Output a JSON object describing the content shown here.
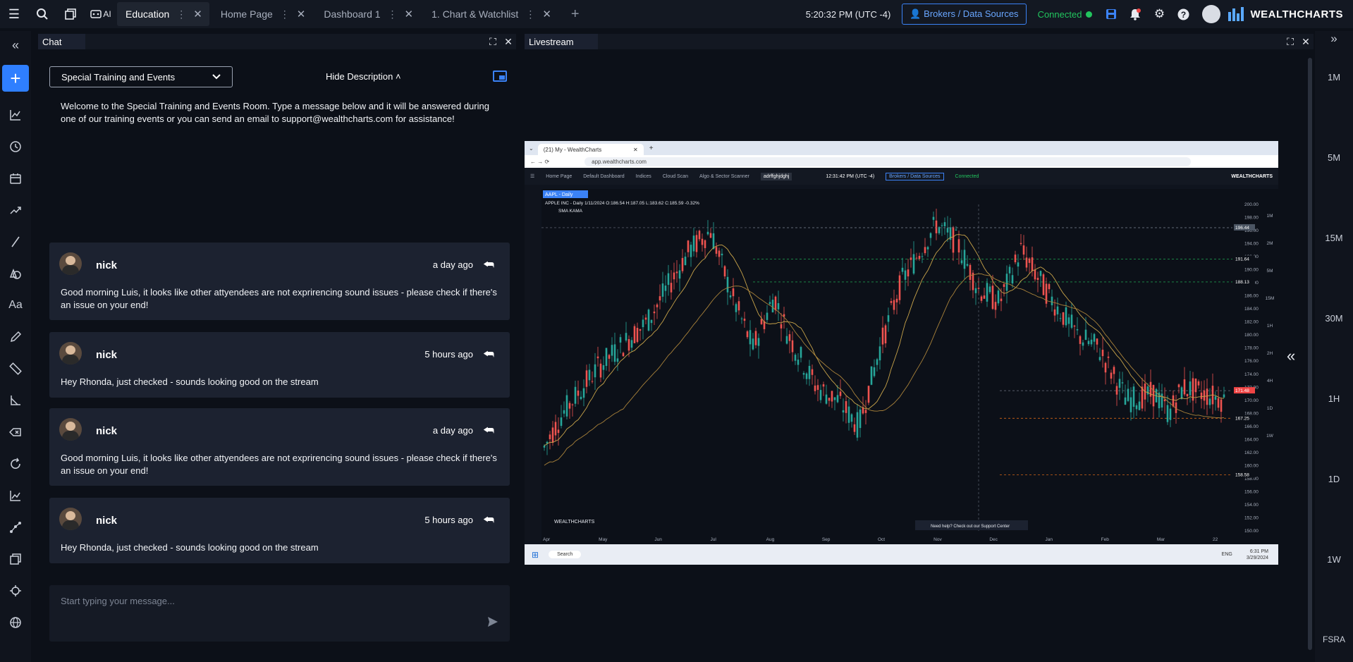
{
  "topbar": {
    "tabs": [
      {
        "label": "Education",
        "active": true
      },
      {
        "label": "Home Page",
        "active": false
      },
      {
        "label": "Dashboard 1",
        "active": false
      },
      {
        "label": "1. Chart & Watchlist",
        "active": false
      }
    ],
    "ai_label": "AI",
    "clock": "5:20:32 PM  (UTC -4)",
    "brokers_label": "Brokers / Data Sources",
    "connection_status": "Connected",
    "brand": "WEALTHCHARTS"
  },
  "chat": {
    "panel_title": "Chat",
    "room_select": "Special Training and Events",
    "hide_description": "Hide Description ˄",
    "welcome": "Welcome to the Special Training and Events Room. Type a message below and it will be answered during one of our training events or you can send an email to support@wealthcharts.com for assistance!",
    "messages": [
      {
        "author": "nick",
        "time": "a day ago",
        "text": "Good morning Luis, it looks like other attyendees are not exprirencing sound issues - please check if there's an issue on your end!"
      },
      {
        "author": "nick",
        "time": "5 hours ago",
        "text": "Hey Rhonda, just checked - sounds looking good on the stream"
      },
      {
        "author": "nick",
        "time": "a day ago",
        "text": "Good morning Luis, it looks like other attyendees are not exprirencing sound issues - please check if there's an issue on your end!"
      },
      {
        "author": "nick",
        "time": "5 hours ago",
        "text": "Hey Rhonda, just checked - sounds looking good on the stream"
      }
    ],
    "composer_placeholder": "Start typing your message..."
  },
  "livestream": {
    "panel_title": "Livestream",
    "shared_screen": {
      "browser_tab": "(21) My - WealthCharts",
      "url": "app.wealthcharts.com",
      "inner_tabs": [
        "Home Page",
        "Default Dashboard",
        "Indices",
        "Cloud Scan",
        "Algo & Sector Scanner",
        "adrffghjdghj"
      ],
      "inner_clock": "12:31:42 PM  (UTC -4)",
      "inner_brokers": "Brokers / Data Sources",
      "inner_connected": "Connected",
      "inner_brand": "WEALTHCHARTS",
      "symbol_badge": "AAPL - Daily",
      "symbol_info": "APPLE INC - Daily  1/11/2024 O:186.54 H:187.05 L:183.62 C:185.59 -0.32%",
      "indicators": "SMA  KAMA",
      "price_axis": [
        "200.00",
        "198.00",
        "196.00",
        "194.00",
        "192.00",
        "190.00",
        "188.00",
        "186.00",
        "184.00",
        "182.00",
        "180.00",
        "178.00",
        "176.00",
        "174.00",
        "172.00",
        "170.00",
        "168.00",
        "166.00",
        "164.00",
        "162.00",
        "160.00",
        "158.00",
        "156.00",
        "154.00",
        "152.00",
        "150.00"
      ],
      "price_tags": [
        "196.44",
        "191.64",
        "188.13",
        "171.48",
        "167.25",
        "158.58"
      ],
      "months": [
        "Apr",
        "May",
        "Jun",
        "Jul",
        "Aug",
        "Sep",
        "Oct",
        "Nov",
        "Dec",
        "Jan",
        "Feb",
        "Mar",
        "22"
      ],
      "inner_timeframes": [
        "1M",
        "2M",
        "5M",
        "15M",
        "1H",
        "2H",
        "4H",
        "1D",
        "1W"
      ],
      "support_toast": "Need help? Check out our Support Center",
      "taskbar_search": "Search",
      "taskbar_time": "6:31 PM",
      "taskbar_date": "3/29/2024",
      "taskbar_lang": "ENG"
    }
  },
  "right_rail": {
    "timeframes": [
      "1M",
      "5M",
      "15M",
      "30M",
      "1H",
      "1D",
      "1W"
    ],
    "footer": "FSRA"
  },
  "colors": {
    "accent": "#2f7fff",
    "connected": "#22c55e",
    "up_candle": "#26a69a",
    "down_candle": "#ef5350",
    "ma1": "#c9a44a",
    "ma2": "#a9823a"
  }
}
